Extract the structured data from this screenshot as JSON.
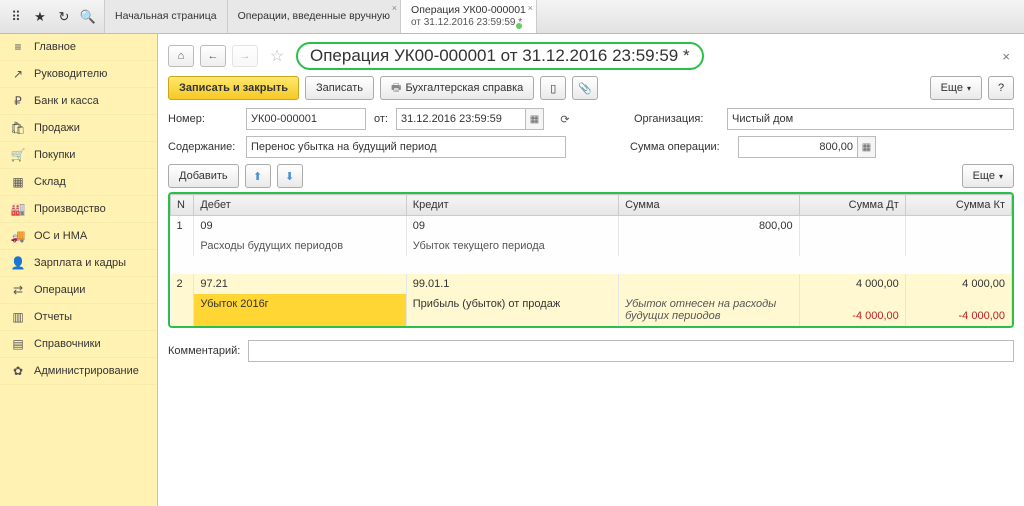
{
  "topbar": {
    "tabs": [
      {
        "title": "Начальная страница",
        "sub": ""
      },
      {
        "title": "Операции, введенные вручную",
        "sub": ""
      },
      {
        "title": "Операция УК00-000001",
        "sub": "от 31.12.2016 23:59:59 *"
      }
    ]
  },
  "sidebar": {
    "items": [
      {
        "icon": "≡",
        "label": "Главное"
      },
      {
        "icon": "↗",
        "label": "Руководителю"
      },
      {
        "icon": "₽",
        "label": "Банк и касса"
      },
      {
        "icon": "🛍",
        "label": "Продажи"
      },
      {
        "icon": "🛒",
        "label": "Покупки"
      },
      {
        "icon": "▦",
        "label": "Склад"
      },
      {
        "icon": "🏭",
        "label": "Производство"
      },
      {
        "icon": "🚚",
        "label": "ОС и НМА"
      },
      {
        "icon": "👤",
        "label": "Зарплата и кадры"
      },
      {
        "icon": "⇄",
        "label": "Операции"
      },
      {
        "icon": "▥",
        "label": "Отчеты"
      },
      {
        "icon": "▤",
        "label": "Справочники"
      },
      {
        "icon": "✿",
        "label": "Администрирование"
      }
    ]
  },
  "document": {
    "title": "Операция УК00-000001 от 31.12.2016 23:59:59 *",
    "toolbar": {
      "save_close": "Записать и закрыть",
      "save": "Записать",
      "print": "Бухгалтерская справка",
      "more": "Еще",
      "help": "?"
    },
    "fields": {
      "number_label": "Номер:",
      "number": "УК00-000001",
      "date_prefix": "от:",
      "date": "31.12.2016 23:59:59",
      "org_label": "Организация:",
      "org": "Чистый дом",
      "content_label": "Содержание:",
      "content": "Перенос убытка на будущий период",
      "sum_label": "Сумма операции:",
      "sum": "800,00"
    },
    "subtoolbar": {
      "add": "Добавить",
      "more": "Еще"
    },
    "table": {
      "headers": {
        "n": "N",
        "debit": "Дебет",
        "credit": "Кредит",
        "sum": "Сумма",
        "sum_dt": "Сумма Дт",
        "sum_kt": "Сумма Кт"
      },
      "rows": [
        {
          "n": "1",
          "debit": "09",
          "debit_sub": "Расходы будущих периодов",
          "credit": "09",
          "credit_sub": "Убыток текущего периода",
          "sum": "800,00",
          "sum_sub": "",
          "sum_dt": "",
          "sum_dt2": "",
          "sum_kt": "",
          "sum_kt2": ""
        },
        {
          "n": "2",
          "debit": "97.21",
          "debit_sub": "Убыток 2016г",
          "credit": "99.01.1",
          "credit_sub": "Прибыль (убыток) от продаж",
          "sum": "",
          "sum_sub": "Убыток отнесен на расходы будущих периодов",
          "sum_dt": "4 000,00",
          "sum_dt2": "-4 000,00",
          "sum_kt": "4 000,00",
          "sum_kt2": "-4 000,00"
        }
      ]
    },
    "comment_label": "Комментарий:",
    "comment": ""
  }
}
